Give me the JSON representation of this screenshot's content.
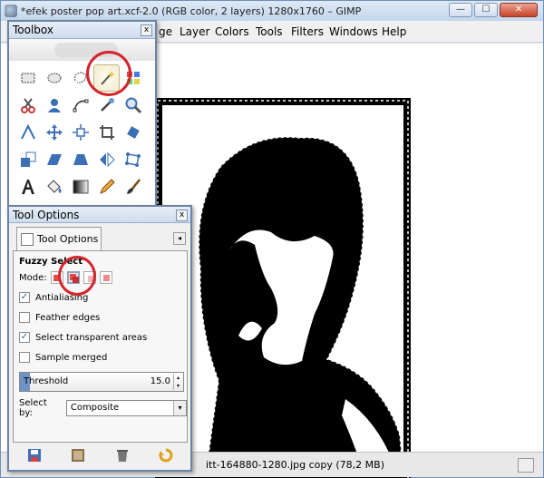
{
  "window": {
    "title": "*efek poster pop art.xcf-2.0 (RGB color, 2 layers) 1280x1760 – GIMP",
    "minimize": "—",
    "maximize": "☐",
    "close": "✕"
  },
  "menubar": {
    "items": [
      "ge",
      "Layer",
      "Colors",
      "Tools",
      "Filters",
      "Windows",
      "Help"
    ]
  },
  "status": {
    "text": "itt-164880-1280.jpg copy (78,2 MB)"
  },
  "toolbox": {
    "title": "Toolbox",
    "close": "x",
    "tools": [
      "rect-select-icon",
      "ellipse-select-icon",
      "free-select-icon",
      "fuzzy-select-icon",
      "select-by-color-icon",
      "scissors-select-icon",
      "foreground-select-icon",
      "paths-icon",
      "color-picker-icon",
      "zoom-icon",
      "measure-icon",
      "move-icon",
      "align-icon",
      "crop-icon",
      "rotate-icon",
      "scale-icon",
      "shear-icon",
      "perspective-icon",
      "flip-icon",
      "cage-transform-icon",
      "text-icon",
      "bucket-fill-icon",
      "blend-icon",
      "pencil-icon",
      "paintbrush-icon"
    ],
    "active_tool": "fuzzy-select-icon"
  },
  "tool_options": {
    "title": "Tool Options",
    "close": "x",
    "tab_label": "Tool Options",
    "heading": "Fuzzy Select",
    "mode_label": "Mode:",
    "antialiasing": {
      "label": "Antialiasing",
      "checked": true
    },
    "feather_edges": {
      "label": "Feather edges",
      "checked": false
    },
    "select_transparent": {
      "label": "Select transparent areas",
      "checked": true
    },
    "sample_merged": {
      "label": "Sample merged",
      "checked": false
    },
    "threshold": {
      "label": "Threshold",
      "value": "15.0",
      "fraction": 0.06
    },
    "select_by": {
      "label": "Select by:",
      "value": "Composite"
    },
    "check_mark": "✓",
    "menu_arrow": "◂",
    "combo_arrow": "▾",
    "spin_up": "▴",
    "spin_down": "▾"
  },
  "colors": {
    "highlight": "#d4242c",
    "accent": "#6f93c7"
  }
}
